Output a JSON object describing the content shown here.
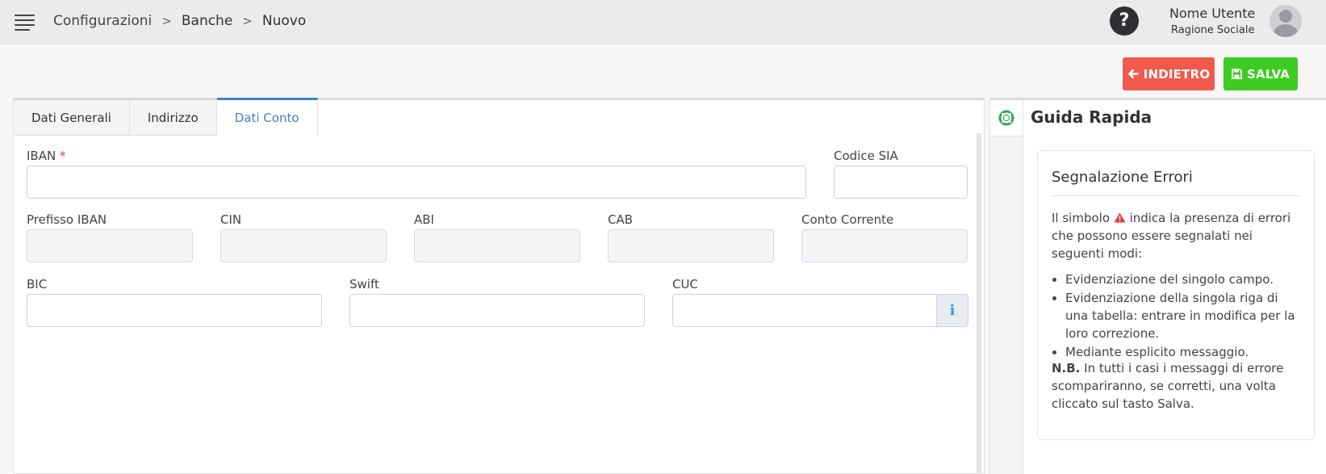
{
  "header": {
    "breadcrumb": [
      "Configurazioni",
      "Banche",
      "Nuovo"
    ],
    "breadcrumb_separator": ">",
    "help_label": "?",
    "user_name": "Nome Utente",
    "user_company": "Ragione Sociale"
  },
  "actions": {
    "back_label": "INDIETRO",
    "save_label": "SALVA",
    "back_color": "#f05a4d",
    "save_color": "#3ecb22"
  },
  "tabs": [
    {
      "label": "Dati Generali",
      "active": false
    },
    {
      "label": "Indirizzo",
      "active": false
    },
    {
      "label": "Dati Conto",
      "active": true
    }
  ],
  "form": {
    "iban_label": "IBAN",
    "required_mark": "*",
    "iban_value": "",
    "codice_sia_label": "Codice SIA",
    "codice_sia_value": "",
    "prefisso_iban_label": "Prefisso IBAN",
    "cin_label": "CIN",
    "abi_label": "ABI",
    "cab_label": "CAB",
    "conto_corrente_label": "Conto Corrente",
    "bic_label": "BIC",
    "swift_label": "Swift",
    "cuc_label": "CUC",
    "cuc_info_icon": "info-icon"
  },
  "guide": {
    "title": "Guida Rapida",
    "icon": "lifebuoy-icon",
    "card_title": "Segnalazione Errori",
    "intro_before": "Il simbolo",
    "intro_after": "indica la presenza di errori che possono essere segnalati nei seguenti modi:",
    "items": [
      "Evidenziazione del singolo campo.",
      "Evidenziazione della singola riga di una tabella: entrare in modifica per la loro correzione.",
      "Mediante esplicito messaggio."
    ],
    "note_bold": "N.B.",
    "note_text": "In tutti i casi i messaggi di errore scompariranno, se corretti, una volta cliccato sul tasto Salva."
  }
}
